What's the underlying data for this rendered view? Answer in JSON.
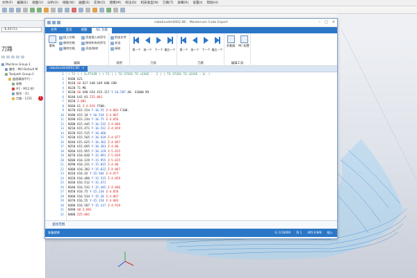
{
  "app": {
    "menu": [
      "文件(F)",
      "编辑(E)",
      "视图(V)",
      "分析(A)",
      "线框(W)",
      "曲面(S)",
      "实体(O)",
      "建模(M)",
      "标注(D)",
      "机床类型(N)",
      "刀路(T)",
      "屏幕(R)",
      "设置(I)",
      "帮助(H)"
    ],
    "coordinate": "-6.40723",
    "panel_title": "刀路",
    "tree": [
      {
        "label": "Machine Group-1",
        "indent": 0,
        "icon": "machine-group-icon"
      },
      {
        "label": "属性 - Mill Default M",
        "indent": 1,
        "icon": "properties-icon"
      },
      {
        "label": "Toolpath Group-1",
        "indent": 1,
        "icon": "toolpath-group-icon"
      },
      {
        "label": "曲面精修平行 -",
        "indent": 2,
        "icon": "operation-icon"
      },
      {
        "label": "参数",
        "indent": 3,
        "icon": "parameters-icon"
      },
      {
        "label": "#1 - M12.00",
        "indent": 3,
        "icon": "tool-icon"
      },
      {
        "label": "图形 - (1)",
        "indent": 3,
        "icon": "geometry-icon"
      },
      {
        "label": "刀路 - 1231",
        "indent": 3,
        "icon": "toolpath-icon"
      }
    ]
  },
  "window": {
    "title": "roboticedm0002.NC - Mastercam Code Expert",
    "tabs": [
      "文件",
      "首页",
      "视图",
      "NC 功能"
    ],
    "active_tab": "NC 功能",
    "document_tab": "roboticedm0002.NC",
    "find_label": "查找范围",
    "status_left": "准备就绪",
    "status_right": [
      "行 1/16000",
      "列 1",
      "465.63KB",
      "插入"
    ]
  },
  "ribbon": {
    "edit_group": {
      "label": "编辑",
      "big": "重新",
      "small": [
        "插入空格",
        "移除空格",
        "删除空格",
        "添加插入的序号",
        "移除所有的序号",
        "添加/移除"
      ]
    },
    "comp_group": {
      "label": "调用",
      "small": [
        "附加文件",
        "发送",
        "接收"
      ]
    },
    "nav1": {
      "label": "刀具",
      "buttons": [
        "第一个",
        "前一个",
        "下一个",
        "最后一个"
      ]
    },
    "nav2": {
      "label": "刀路",
      "buttons": [
        "第一个",
        "前一个",
        "下一个",
        "最后一个"
      ]
    },
    "tools_group": {
      "label": "编辑工具",
      "big": [
        "多重器",
        "NC 配置"
      ]
    }
  },
  "code": [
    {
      "n": "1",
      "parts": [
        [
          "c-com",
          "( T1 ) ( D=PT42M ) ( F1 ) ( TO STOCK TO LEAVE - .2 ) ( TO STOCK TO LEAVE - 0. )"
        ]
      ]
    },
    {
      "n": "2",
      "parts": [
        [
          "c-blk",
          "N100 G21"
        ]
      ]
    },
    {
      "n": "3",
      "parts": [
        [
          "c-blk",
          "N110 "
        ],
        [
          "c-red",
          "G0"
        ],
        [
          "c-blk",
          " G17 G40 G49 G80 G90"
        ]
      ]
    },
    {
      "n": "4",
      "parts": [
        [
          "c-blk",
          "N120 T1 M6"
        ]
      ]
    },
    {
      "n": "5",
      "parts": [
        [
          "c-blk",
          "N130 "
        ],
        [
          "c-red",
          "G0"
        ],
        [
          "c-blk",
          " G90 G54 X15.117 "
        ],
        [
          "c-blu",
          "Y-16.587"
        ],
        [
          "c-blk",
          " A0. S1000 M3"
        ]
      ]
    },
    {
      "n": "6",
      "parts": [
        [
          "c-blk",
          "N140 G43 H1 "
        ],
        [
          "c-red",
          "Z25.881"
        ]
      ]
    },
    {
      "n": "7",
      "parts": [
        [
          "c-blk",
          "N150 "
        ],
        [
          "c-red",
          "Z.881"
        ]
      ]
    },
    {
      "n": "8",
      "parts": [
        [
          "c-blk",
          "N160 G1 "
        ],
        [
          "c-red",
          "Z-4.919"
        ],
        [
          "c-blk",
          " F500."
        ]
      ]
    },
    {
      "n": "9",
      "parts": [
        [
          "c-blk",
          "N170 X15.154 "
        ],
        [
          "c-blu",
          "Y-16.55"
        ],
        [
          "c-blk",
          " "
        ],
        [
          "c-red",
          "Z-4.883"
        ],
        [
          "c-blk",
          " F100."
        ]
      ]
    },
    {
      "n": "10",
      "parts": [
        [
          "c-blk",
          "N180 X15.18 "
        ],
        [
          "c-blu",
          "Y-16.534"
        ],
        [
          "c-blk",
          " "
        ],
        [
          "c-red",
          "Z-4.867"
        ]
      ]
    },
    {
      "n": "11",
      "parts": [
        [
          "c-blk",
          "N190 X15.234 "
        ],
        [
          "c-blu",
          "Y-16.75"
        ],
        [
          "c-blk",
          " "
        ],
        [
          "c-red",
          "Z-4.856"
        ]
      ]
    },
    {
      "n": "12",
      "parts": [
        [
          "c-blk",
          "N200 X15.445 "
        ],
        [
          "c-blu",
          "Y-16.532"
        ],
        [
          "c-blk",
          " "
        ],
        [
          "c-red",
          "Z-4.866"
        ]
      ]
    },
    {
      "n": "13",
      "parts": [
        [
          "c-blk",
          "N210 X15.471 "
        ],
        [
          "c-blu",
          "Y-16.512"
        ],
        [
          "c-blk",
          " "
        ],
        [
          "c-red",
          "Z-4.859"
        ]
      ]
    },
    {
      "n": "14",
      "parts": [
        [
          "c-blk",
          "N220 X15.515 "
        ],
        [
          "c-blu",
          "Y-16.466"
        ]
      ]
    },
    {
      "n": "15",
      "parts": [
        [
          "c-blk",
          "N230 X15.565 "
        ],
        [
          "c-blu",
          "Y-16.419"
        ],
        [
          "c-blk",
          " "
        ],
        [
          "c-red",
          "Z-4.877"
        ]
      ]
    },
    {
      "n": "16",
      "parts": [
        [
          "c-blk",
          "N240 X15.625 "
        ],
        [
          "c-blu",
          "Y-16.362"
        ],
        [
          "c-blk",
          " "
        ],
        [
          "c-red",
          "Z-4.867"
        ]
      ]
    },
    {
      "n": "17",
      "parts": [
        [
          "c-blk",
          "N250 X15.695 "
        ],
        [
          "c-blu",
          "Y-16.281"
        ],
        [
          "c-blk",
          " "
        ],
        [
          "c-red",
          "Z-4.86"
        ]
      ]
    },
    {
      "n": "18",
      "parts": [
        [
          "c-blk",
          "N260 X15.955 "
        ],
        [
          "c-blu",
          "Y-16.129"
        ],
        [
          "c-blk",
          " "
        ],
        [
          "c-red",
          "Z-5.015"
        ]
      ]
    },
    {
      "n": "19",
      "parts": [
        [
          "c-blk",
          "N270 X16.036 "
        ],
        [
          "c-blu",
          "Y-15.991"
        ],
        [
          "c-blk",
          " "
        ],
        [
          "c-red",
          "Z-5.059"
        ]
      ]
    },
    {
      "n": "20",
      "parts": [
        [
          "c-blk",
          "N280 X16.129 "
        ],
        [
          "c-blu",
          "Y-15.955"
        ],
        [
          "c-blk",
          " "
        ],
        [
          "c-red",
          "Z-5.015"
        ]
      ]
    },
    {
      "n": "21",
      "parts": [
        [
          "c-blk",
          "N290 X16.231 "
        ],
        [
          "c-blu",
          "Y-15.815"
        ],
        [
          "c-blk",
          " "
        ],
        [
          "c-red",
          "Z-4.86"
        ]
      ]
    },
    {
      "n": "22",
      "parts": [
        [
          "c-blk",
          "N300 X16.382 "
        ],
        [
          "c-blu",
          "Y-15.622"
        ],
        [
          "c-blk",
          " "
        ],
        [
          "c-red",
          "Z-4.867"
        ]
      ]
    },
    {
      "n": "23",
      "parts": [
        [
          "c-blk",
          "N310 X16.42 "
        ],
        [
          "c-blu",
          "Y-15.564"
        ],
        [
          "c-blk",
          " "
        ],
        [
          "c-red",
          "Z-4.877"
        ]
      ]
    },
    {
      "n": "24",
      "parts": [
        [
          "c-blk",
          "N320 X16.486 "
        ],
        [
          "c-blu",
          "Y-15.515"
        ],
        [
          "c-blk",
          " "
        ],
        [
          "c-red",
          "Z-4.859"
        ]
      ]
    },
    {
      "n": "25",
      "parts": [
        [
          "c-blk",
          "N330 X16.512 "
        ],
        [
          "c-blu",
          "Y-15.471"
        ]
      ]
    },
    {
      "n": "26",
      "parts": [
        [
          "c-blk",
          "N340 X16.532 "
        ],
        [
          "c-blu",
          "Y-15.445"
        ],
        [
          "c-blk",
          " "
        ],
        [
          "c-red",
          "Z-4.866"
        ]
      ]
    },
    {
      "n": "27",
      "parts": [
        [
          "c-blk",
          "N350 X16.75 "
        ],
        [
          "c-blu",
          "Y-15.234"
        ],
        [
          "c-blk",
          " "
        ],
        [
          "c-red",
          "Z-4.856"
        ]
      ]
    },
    {
      "n": "28",
      "parts": [
        [
          "c-blk",
          "N360 X16.534 "
        ],
        [
          "c-blu",
          "Y-15.18"
        ],
        [
          "c-blk",
          " "
        ],
        [
          "c-red",
          "Z-4.867"
        ]
      ]
    },
    {
      "n": "29",
      "parts": [
        [
          "c-blk",
          "N370 X16.55 "
        ],
        [
          "c-blu",
          "Y-15.154"
        ],
        [
          "c-blk",
          " "
        ],
        [
          "c-red",
          "Z-4.883"
        ]
      ]
    },
    {
      "n": "30",
      "parts": [
        [
          "c-blk",
          "N380 X16.587 "
        ],
        [
          "c-blu",
          "Y-15.117"
        ],
        [
          "c-blk",
          " "
        ],
        [
          "c-red",
          "Z-4.919"
        ]
      ]
    },
    {
      "n": "31",
      "parts": [
        [
          "c-blk",
          "N390 "
        ],
        [
          "c-red",
          "G0"
        ],
        [
          "c-blk",
          " "
        ],
        [
          "c-red",
          "Z.881"
        ]
      ]
    },
    {
      "n": "32",
      "parts": [
        [
          "c-blk",
          "N400 "
        ],
        [
          "c-red",
          "Z25.881"
        ]
      ]
    }
  ]
}
